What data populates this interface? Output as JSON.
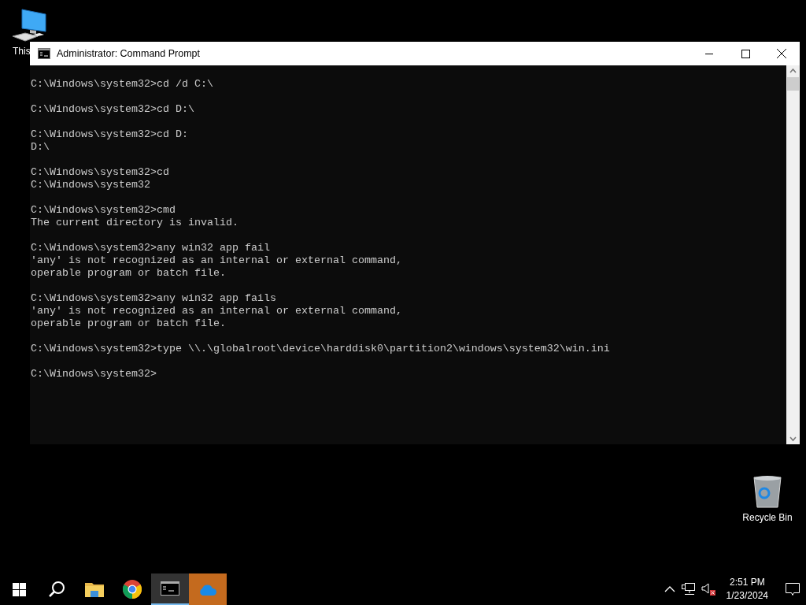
{
  "desktop_icons": [
    {
      "kind": "computer",
      "label": "This"
    },
    {
      "kind": "recycle",
      "label": "Recycle Bin"
    }
  ],
  "window": {
    "title": "Administrator: Command Prompt"
  },
  "console": {
    "blocks": [
      [
        "C:\\Windows\\system32>cd /d C:\\"
      ],
      [
        "C:\\Windows\\system32>cd D:\\"
      ],
      [
        "C:\\Windows\\system32>cd D:",
        "D:\\"
      ],
      [
        "C:\\Windows\\system32>cd",
        "C:\\Windows\\system32"
      ],
      [
        "C:\\Windows\\system32>cmd",
        "The current directory is invalid."
      ],
      [
        "C:\\Windows\\system32>any win32 app fail",
        "'any' is not recognized as an internal or external command,",
        "operable program or batch file."
      ],
      [
        "C:\\Windows\\system32>any win32 app fails",
        "'any' is not recognized as an internal or external command,",
        "operable program or batch file."
      ],
      [
        "C:\\Windows\\system32>type \\\\.\\globalroot\\device\\harddisk0\\partition2\\windows\\system32\\win.ini"
      ],
      [
        "C:\\Windows\\system32>"
      ]
    ]
  },
  "taskbar": {
    "items": [
      {
        "kind": "start",
        "active": false,
        "flashing": false
      },
      {
        "kind": "search",
        "active": false,
        "flashing": false
      },
      {
        "kind": "files",
        "active": false,
        "flashing": false
      },
      {
        "kind": "browser",
        "active": false,
        "flashing": false
      },
      {
        "kind": "terminal",
        "active": true,
        "flashing": false
      },
      {
        "kind": "cloud",
        "active": false,
        "flashing": true
      }
    ],
    "tray": {
      "time": "2:51 PM",
      "date": "1/23/2024",
      "volume_muted": true
    }
  }
}
